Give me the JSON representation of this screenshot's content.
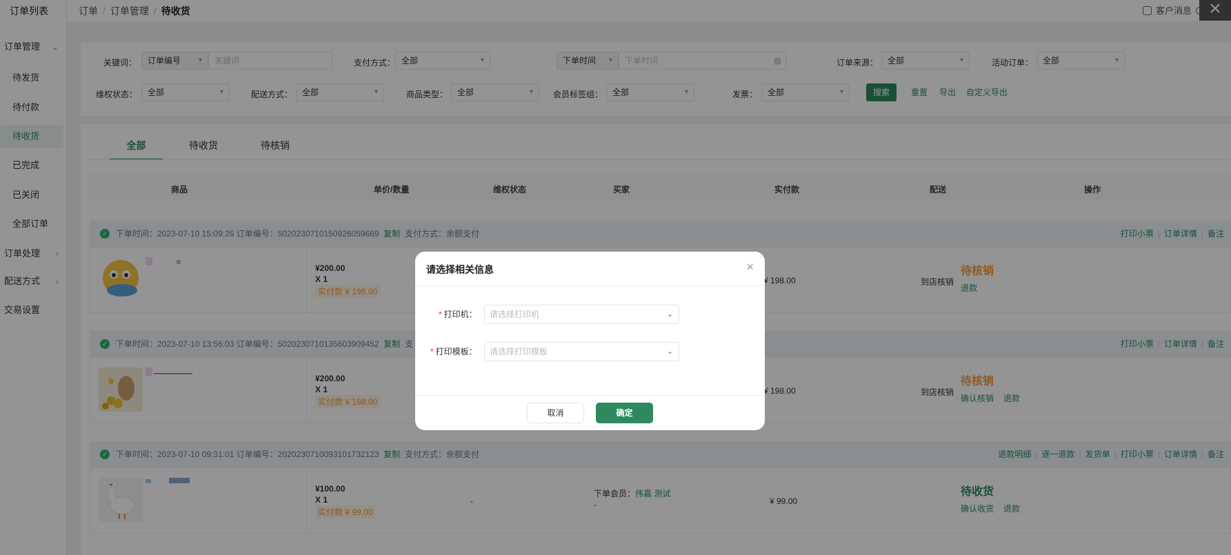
{
  "sidebar": {
    "brand": "订单列表",
    "group_order_manage": "订单管理",
    "items": [
      "待发货",
      "待付款",
      "待收货",
      "已完成",
      "已关闭",
      "全部订单"
    ],
    "active_index": 2,
    "group_order_process": "订单处理",
    "group_delivery": "配送方式",
    "group_trade_settings": "交易设置"
  },
  "topbar": {
    "crumb1": "订单",
    "crumb2": "订单管理",
    "crumb3": "待收货",
    "customer_msg": "客户消息"
  },
  "filters": {
    "keyword_label": "关键词：",
    "keyword_type": "订单编号",
    "keyword_placeholder": "关键词",
    "pay_label": "支付方式：",
    "pay_value": "全部",
    "time_type": "下单时间",
    "time_placeholder": "下单时间",
    "source_label": "订单来源：",
    "source_value": "全部",
    "activity_label": "活动订单：",
    "activity_value": "全部",
    "rights_label": "维权状态：",
    "rights_value": "全部",
    "delivery_label": "配送方式：",
    "delivery_value": "全部",
    "goods_type_label": "商品类型：",
    "goods_type_value": "全部",
    "member_tag_label": "会员标签组：",
    "member_tag_value": "全部",
    "invoice_label": "发票：",
    "invoice_value": "全部",
    "search_btn": "搜索",
    "reset": "重置",
    "export": "导出",
    "custom_export": "自定义导出"
  },
  "tabs": [
    "全部",
    "待收货",
    "待核销"
  ],
  "columns": [
    "商品",
    "单价/数量",
    "维权状态",
    "买家",
    "实付款",
    "配送",
    "操作"
  ],
  "orders": [
    {
      "head": "下单时间：2023-07-10 15:09:26    订单编号：5020230710150926059669",
      "copy": "复制",
      "pay": "支付方式：余额支付",
      "actions": [
        "打印小票",
        "订单详情",
        "备注"
      ],
      "unit_price": "¥200.00",
      "qty": "X 1",
      "paid_tag": "实付款 ¥ 198.00",
      "paid": "¥ 198.00",
      "delivery": "到店核销",
      "status": "待核销",
      "status_color": "#f39c37",
      "status_actions": [
        "退款"
      ]
    },
    {
      "head": "下单时间：2023-07-10 13:56:03    订单编号：5020230710135603909452",
      "copy": "复制",
      "pay": "支",
      "actions": [
        "打印小票",
        "订单详情",
        "备注"
      ],
      "unit_price": "¥200.00",
      "qty": "X 1",
      "paid_tag": "实付款 ¥ 198.00",
      "paid": "¥ 198.00",
      "delivery": "到店核销",
      "status": "待核销",
      "status_color": "#f39c37",
      "status_actions": [
        "确认核销",
        "退款"
      ]
    },
    {
      "head": "下单时间：2023-07-10 09:31:01    订单编号：2020230710093101732123",
      "copy": "复制",
      "pay": "支付方式：余额支付",
      "actions": [
        "退款明细",
        "逐一退款",
        "发货单",
        "打印小票",
        "订单详情",
        "备注"
      ],
      "unit_price": "¥100.00",
      "qty": "X 1",
      "paid_tag": "实付款 ¥ 99.00",
      "rights": "-",
      "buyer_label": "下单会员：",
      "buyer_name": "伟嘉 测试",
      "buyer_sub": "-",
      "paid": "¥ 99.00",
      "status": "待收货",
      "status_color": "#2e8a5e",
      "status_actions": [
        "确认收货",
        "退款"
      ]
    }
  ],
  "modal": {
    "title": "请选择相关信息",
    "printer_label": "打印机：",
    "printer_placeholder": "请选择打印机",
    "template_label": "打印模板：",
    "template_placeholder": "请选择打印模板",
    "cancel": "取消",
    "confirm": "确定"
  }
}
